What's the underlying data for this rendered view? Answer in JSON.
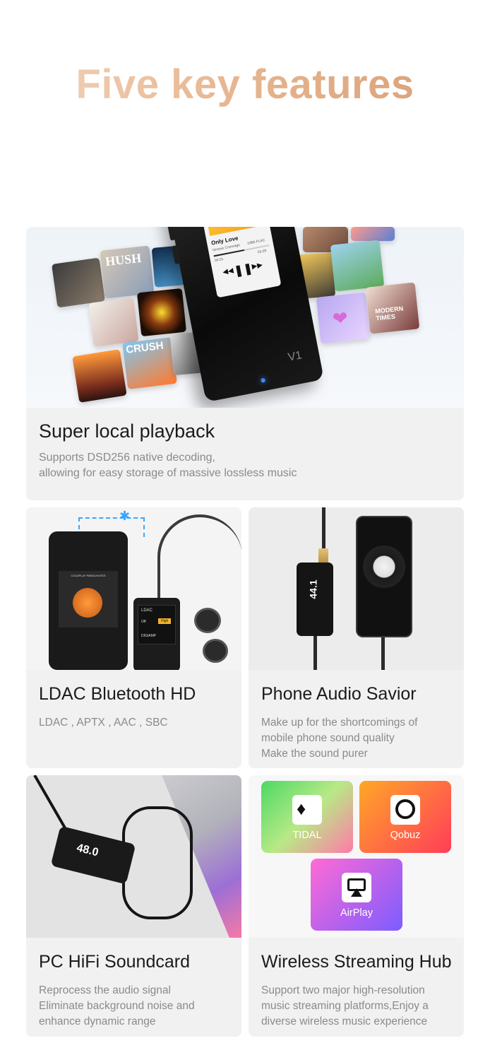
{
  "headline": "Five key features",
  "device": {
    "track_title": "Only Love",
    "track_artist": "Groove Coverage",
    "quality": "24Bit FLAC",
    "time_elapsed": "00:31",
    "time_total": "03:29",
    "brand": "V1"
  },
  "features": [
    {
      "title": "Super local playback",
      "description": "Supports DSD256 native decoding,\nallowing for easy storage of massive lossless music"
    },
    {
      "title": "LDAC Bluetooth HD",
      "description": "LDAC , APTX , AAC , SBC"
    },
    {
      "title": "Phone Audio Savior",
      "description": "Make up for the shortcomings of\nmobile phone sound quality\nMake the sound purer"
    },
    {
      "title": "PC HiFi Soundcard",
      "description": "Reprocess the audio signal\nEliminate background noise and\nenhance dynamic range"
    },
    {
      "title": "Wireless Streaming Hub",
      "description": "Support two major high-resolution\nmusic streaming platforms,Enjoy a\ndiverse wireless music experience"
    }
  ],
  "album_labels": [
    "HUSH",
    "CRUSH",
    "MODERN TIMES",
    "COLDPLAY"
  ],
  "phone_screen": {
    "album_label": "COLDPLAY PARACHUTES"
  },
  "small_device": {
    "label_1": "LDAC",
    "option_on": "Off",
    "option_high": "High",
    "option_mode": "DIGIAMP"
  },
  "display_rate": "44.1",
  "display_rate_pc": "48.0",
  "services": [
    {
      "name": "TIDAL",
      "icon": "tidal-icon",
      "color_start": "#4cd964",
      "color_end": "#ff7aa8"
    },
    {
      "name": "Qobuz",
      "icon": "qobuz-icon",
      "color_start": "#ffa726",
      "color_end": "#ff3d5a"
    },
    {
      "name": "AirPlay",
      "icon": "airplay-icon",
      "color_start": "#ff6ad5",
      "color_end": "#7c5cff"
    }
  ],
  "colors": {
    "headline_gradient_start": "#f3d6bf",
    "headline_gradient_end": "#d79f78",
    "card_background": "#f1f1f1",
    "description_text": "#8a8a8a",
    "device_led": "#3d8bff"
  }
}
